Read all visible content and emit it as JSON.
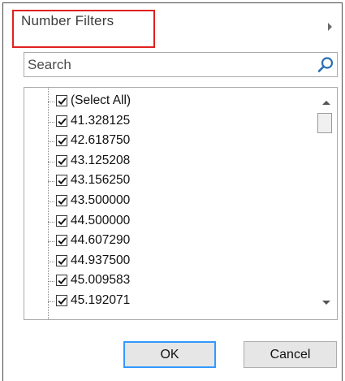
{
  "menu": {
    "number_filters_label": "Number Filters",
    "submenu_arrow_icon": "chevron-right-icon",
    "highlight_color": "#e02020"
  },
  "search": {
    "placeholder": "Search",
    "value": "",
    "icon": "search-icon"
  },
  "list": {
    "items": [
      {
        "label": "(Select All)",
        "checked": true
      },
      {
        "label": "41.328125",
        "checked": true
      },
      {
        "label": "42.618750",
        "checked": true
      },
      {
        "label": "43.125208",
        "checked": true
      },
      {
        "label": "43.156250",
        "checked": true
      },
      {
        "label": "43.500000",
        "checked": true
      },
      {
        "label": "44.500000",
        "checked": true
      },
      {
        "label": "44.607290",
        "checked": true
      },
      {
        "label": "44.937500",
        "checked": true
      },
      {
        "label": "45.009583",
        "checked": true
      },
      {
        "label": "45.192071",
        "checked": true
      }
    ]
  },
  "buttons": {
    "ok_label": "OK",
    "cancel_label": "Cancel"
  }
}
